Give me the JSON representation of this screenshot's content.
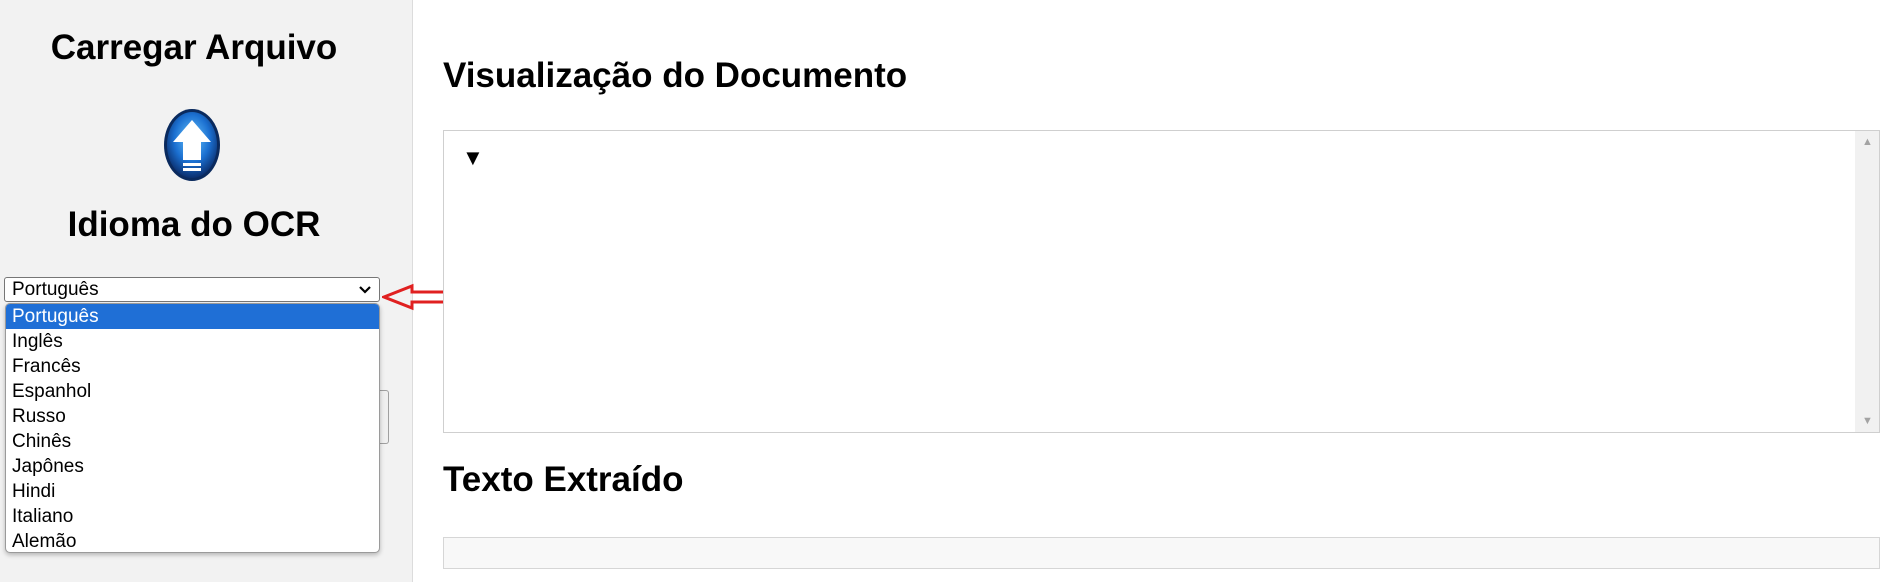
{
  "sidebar": {
    "upload_title": "Carregar Arquivo",
    "upload_icon": "upload-arrow-icon",
    "ocr_title": "Idioma do OCR",
    "language_select": {
      "value": "Português",
      "options": [
        "Português",
        "Inglês",
        "Francês",
        "Espanhol",
        "Russo",
        "Chinês",
        "Japônes",
        "Hindi",
        "Italiano",
        "Alemão"
      ]
    },
    "annotation_arrow_color": "#e02020"
  },
  "main": {
    "preview_title": "Visualização do Documento",
    "preview_toggle": "▼",
    "extracted_title": "Texto Extraído"
  },
  "colors": {
    "accent": "#1f6fd6"
  }
}
